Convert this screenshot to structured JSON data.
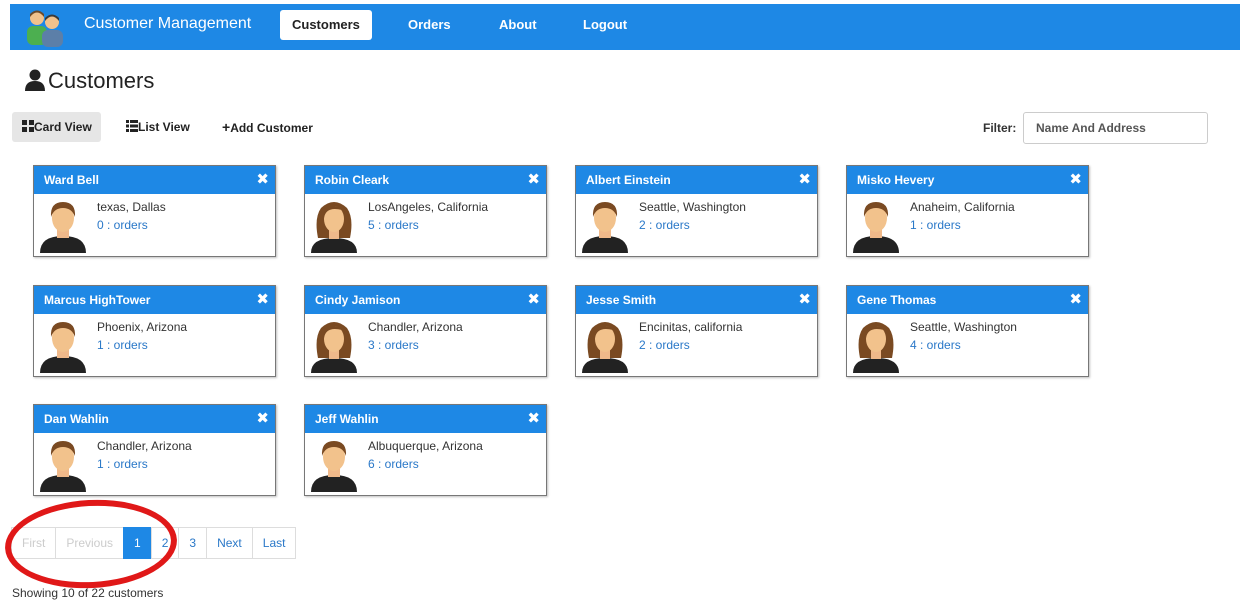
{
  "nav": {
    "brand": "Customer Management",
    "items": [
      {
        "label": "Customers",
        "active": true
      },
      {
        "label": "Orders"
      },
      {
        "label": "About"
      },
      {
        "label": "Logout"
      }
    ]
  },
  "page": {
    "title": "Customers",
    "icon": "user-icon"
  },
  "toolbar": {
    "card_view": "Card View",
    "list_view": "List View",
    "add_customer": "Add Customer",
    "filter_label": "Filter:",
    "filter_placeholder": "Name And Address"
  },
  "customers": [
    {
      "name": "Ward Bell",
      "location": "texas, Dallas",
      "orders": "0 : orders",
      "gender": "male"
    },
    {
      "name": "Robin Cleark",
      "location": "LosAngeles, California",
      "orders": "5 : orders",
      "gender": "female"
    },
    {
      "name": "Albert Einstein",
      "location": "Seattle, Washington",
      "orders": "2 : orders",
      "gender": "male"
    },
    {
      "name": "Misko Hevery",
      "location": "Anaheim, California",
      "orders": "1 : orders",
      "gender": "male"
    },
    {
      "name": "Marcus HighTower",
      "location": "Phoenix, Arizona",
      "orders": "1 : orders",
      "gender": "male"
    },
    {
      "name": "Cindy Jamison",
      "location": "Chandler, Arizona",
      "orders": "3 : orders",
      "gender": "female"
    },
    {
      "name": "Jesse Smith",
      "location": "Encinitas, california",
      "orders": "2 : orders",
      "gender": "female"
    },
    {
      "name": "Gene Thomas",
      "location": "Seattle, Washington",
      "orders": "4 : orders",
      "gender": "female"
    },
    {
      "name": "Dan Wahlin",
      "location": "Chandler, Arizona",
      "orders": "1 : orders",
      "gender": "male"
    },
    {
      "name": "Jeff Wahlin",
      "location": "Albuquerque, Arizona",
      "orders": "6 : orders",
      "gender": "male"
    }
  ],
  "pagination": {
    "first": "First",
    "previous": "Previous",
    "pages": [
      "1",
      "2",
      "3"
    ],
    "current": "1",
    "next": "Next",
    "last": "Last"
  },
  "footer": {
    "showing": "Showing 10 of 22 customers"
  },
  "colors": {
    "primary": "#1e88e5",
    "link": "#2a78c8",
    "annotation": "#e01818"
  }
}
